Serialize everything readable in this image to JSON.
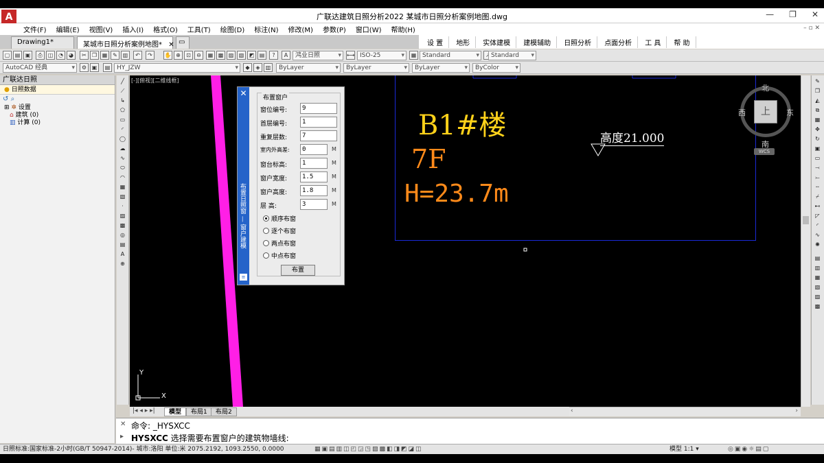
{
  "app": {
    "logo_letter": "A",
    "title": "广联达建筑日照分析2022    某城市日照分析案例地图.dwg",
    "window_controls": [
      "—",
      "❐",
      "✕"
    ]
  },
  "menu": {
    "items": [
      "文件(F)",
      "编辑(E)",
      "视图(V)",
      "插入(I)",
      "格式(O)",
      "工具(T)",
      "绘图(D)",
      "标注(N)",
      "修改(M)",
      "参数(P)",
      "窗口(W)",
      "帮助(H)"
    ],
    "right_tools": "– ▫ ✕"
  },
  "doc_tabs": [
    {
      "label": "Drawing1*"
    },
    {
      "label": "某城市日照分析案例地图*",
      "close": "✕"
    }
  ],
  "hy_toolbar": [
    "设 置",
    "地形",
    "实体建模",
    "建模辅助",
    "日照分析",
    "点面分析",
    "工 具",
    "帮 助"
  ],
  "toolbar1": {
    "font_combo": "鸿业日照",
    "dim_combo": "ISO-25",
    "text_style": "Standard",
    "table_style": "Standard"
  },
  "toolbar2": {
    "workspace": "AutoCAD 经典",
    "layer": "HY_JZW",
    "color": "ByLayer",
    "linetype": "ByLayer",
    "lineweight": "ByLayer",
    "plotstyle": "ByColor"
  },
  "left_panel": {
    "title": "广联达日照",
    "tab": "日照数据",
    "tree": [
      {
        "label": "设置"
      },
      {
        "label": "建筑  (0)"
      },
      {
        "label": "计算  (0)"
      }
    ]
  },
  "canvas": {
    "view_label": "[-][俯视][二维线框]",
    "building_name": "B1#楼",
    "floors": "7F",
    "height": "H=23.7m",
    "elevation_label": "高度21.000",
    "compass": {
      "north": "北",
      "south": "南",
      "east": "东",
      "west": "西",
      "center": "上",
      "wcs": "WCS"
    },
    "ucs": {
      "x": "X",
      "y": "Y"
    }
  },
  "dialog": {
    "strip_label": "布置日照窗 — 窗户建模",
    "group_title": "布置窗户",
    "fields": [
      {
        "label": "窗位编号:",
        "value": "9"
      },
      {
        "label": "首层编号:",
        "value": "1"
      },
      {
        "label": "重复层数:",
        "value": "7"
      },
      {
        "label": "室内外高差:",
        "value": "0",
        "unit": "M"
      },
      {
        "label": "窗台标高:",
        "value": "1",
        "unit": "M"
      },
      {
        "label": "窗户宽度:",
        "value": "1.5",
        "unit": "M"
      },
      {
        "label": "窗户高度:",
        "value": "1.8",
        "unit": "M"
      },
      {
        "label": "层    高:",
        "value": "3",
        "unit": "M"
      }
    ],
    "options": [
      {
        "label": "顺序布窗",
        "checked": true
      },
      {
        "label": "逐个布窗",
        "checked": false
      },
      {
        "label": "两点布窗",
        "checked": false
      },
      {
        "label": "中点布窗",
        "checked": false
      }
    ],
    "button": "布置"
  },
  "layout_tabs": [
    "模型",
    "布局1",
    "布局2"
  ],
  "command": {
    "line1": "命令: _HYSXCC",
    "line2_cmd": "HYSXCC",
    "line2_text": "选择需要布置窗户的建筑物墙线:"
  },
  "status": {
    "left": "日照标准:国家标准-2小时(GB/T 50947-2014)- 城市:洛阳 单位:米  2075.2192, 1093.2550, 0.0000",
    "right": "模型   1:1 ▾"
  }
}
